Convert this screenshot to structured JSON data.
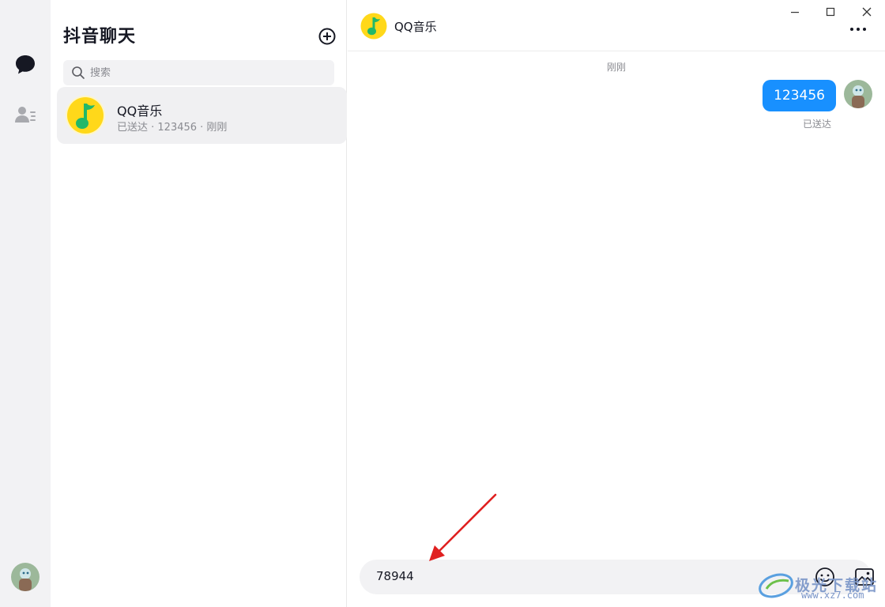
{
  "sidebar": {
    "chat_icon": "chat-bubble-icon",
    "contacts_icon": "contacts-icon"
  },
  "list": {
    "title": "抖音聊天",
    "add_icon": "plus-circle-icon",
    "search": {
      "placeholder": "搜索",
      "value": ""
    },
    "conversations": [
      {
        "name": "QQ音乐",
        "subtitle": "已送达 · 123456 · 刚刚"
      }
    ]
  },
  "chat": {
    "contact_name": "QQ音乐",
    "time_separator": "刚刚",
    "messages": [
      {
        "from": "me",
        "text": "123456",
        "status": "已送达"
      }
    ],
    "composer": {
      "value": "78944"
    },
    "more_icon": "more-horizontal-icon",
    "emoji_icon": "emoji-icon",
    "image_icon": "image-icon"
  },
  "window_controls": [
    "minimize-icon",
    "maximize-icon",
    "close-icon"
  ],
  "watermark": {
    "text": "极光下载站",
    "url": "www.xz7.com"
  },
  "colors": {
    "accent": "#1890ff",
    "rail_bg": "#f2f2f4",
    "qq_yellow": "#ffd81a",
    "qq_green": "#21b869",
    "annotation_red": "#e02020"
  }
}
